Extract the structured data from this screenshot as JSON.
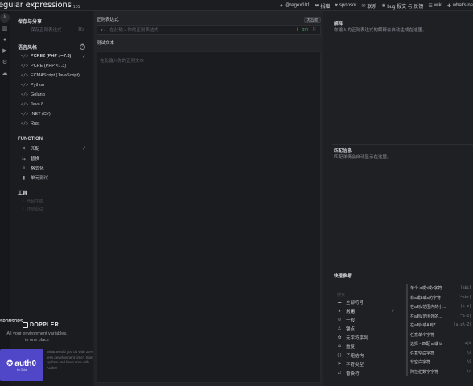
{
  "header": {
    "brand": "egular expressions",
    "version": "101",
    "links": [
      {
        "icon": "twitter-icon",
        "glyph": "✦",
        "label": "@regex101"
      },
      {
        "icon": "donate-icon",
        "glyph": "❤",
        "label": "捐赠"
      },
      {
        "icon": "sponsor-icon",
        "glyph": "♥",
        "label": "sponsor"
      },
      {
        "icon": "mail-icon",
        "glyph": "✉",
        "label": "联系"
      },
      {
        "icon": "bug-icon",
        "glyph": "✱",
        "label": "bug 报交 与 反馈"
      },
      {
        "icon": "wiki-icon",
        "glyph": "☰",
        "label": "wiki"
      },
      {
        "icon": "whats-new-icon",
        "glyph": "✚",
        "label": "what's ne"
      }
    ]
  },
  "sidebar": {
    "save_share_title": "保存与分享",
    "save_share_row": {
      "label": "保存正则表达式",
      "shortcut": "⌘s"
    },
    "flavor_title": "语言风格",
    "flavors": [
      {
        "label": "PCRE2 (PHP >=7.3)",
        "active": true
      },
      {
        "label": "PCRE (PHP <7.3)",
        "active": false
      },
      {
        "label": "ECMAScript (JavaScript)",
        "active": false
      },
      {
        "label": "Python",
        "active": false
      },
      {
        "label": "Golang",
        "active": false
      },
      {
        "label": "Java 8",
        "active": false
      },
      {
        "label": ".NET (C#)",
        "active": false
      },
      {
        "label": "Rust",
        "active": false
      }
    ],
    "function_title": "FUNCTION",
    "functions": [
      {
        "icon": "match-icon",
        "glyph": "⌗",
        "label": "匹配",
        "active": true
      },
      {
        "icon": "substitution-icon",
        "glyph": "⇆",
        "label": "替换",
        "active": false
      },
      {
        "icon": "list-icon",
        "glyph": "≡",
        "label": "格式化",
        "active": false
      },
      {
        "icon": "unit-test-icon",
        "glyph": "▮",
        "label": "单元测试",
        "active": false
      }
    ],
    "tools_title": "工具",
    "tools": [
      "代码生成",
      "正则调试"
    ],
    "sponsors_title": "SPONSORS",
    "doppler_name": "DOPPLER",
    "doppler_tagline": "All your environment variables, in one place",
    "auth0_name": "auth0",
    "auth0_sub": "by Okta",
    "auth0_copy": "What would you do with 25% less development time? Sign up free and have time with Auth0!"
  },
  "editor": {
    "regex_title": "正则表达式",
    "regex_badge": "无匹配",
    "regex_delim_open": "r /",
    "regex_placeholder": "在此输入你的正则表达式",
    "regex_delim_close": "/",
    "regex_flags": "gm",
    "test_title": "测试文本",
    "test_placeholder": "在此输入你的正则文本"
  },
  "right": {
    "explanation_title": "解释",
    "explanation_desc": "你输入的正则表达式的解释会自动生成在这里。",
    "match_title": "匹配信息",
    "match_desc": "匹配详情会自动显示在这里。",
    "quickref_title": "快速参考",
    "quickref_search_placeholder": "搜索",
    "categories": [
      {
        "icon": "all-tokens-icon",
        "glyph": "☁",
        "label": "全部符号",
        "active": false
      },
      {
        "icon": "star-icon",
        "glyph": "★",
        "label": "常用",
        "active": true
      },
      {
        "icon": "general-icon",
        "glyph": "⊙",
        "label": "一般",
        "active": false
      },
      {
        "icon": "anchor-icon",
        "glyph": "⚓",
        "label": "锚点",
        "active": false
      },
      {
        "icon": "meta-icon",
        "glyph": "✿",
        "label": "元字符序列",
        "active": false
      },
      {
        "icon": "quantifier-icon",
        "glyph": "⊕",
        "label": "重复",
        "active": false
      },
      {
        "icon": "group-icon",
        "glyph": "( )",
        "label": "子组结构",
        "active": false
      },
      {
        "icon": "flag-icon",
        "glyph": "⚑",
        "label": "字符类型",
        "active": false
      },
      {
        "icon": "replace-icon",
        "glyph": "⇄",
        "label": "替换符",
        "active": false
      }
    ],
    "items": [
      {
        "label": "单个 a或b或c字符",
        "token": "[abc]"
      },
      {
        "label": "非a或b或c的字符",
        "token": "[^abc]"
      },
      {
        "label": "在a到z范围内的小...",
        "token": "[a-z]"
      },
      {
        "label": "在a到z范围外的...",
        "token": "[^a-z]"
      },
      {
        "label": "在a到z或A到Z...",
        "token": "[a-zA-Z]"
      },
      {
        "label": "任意单个字符",
        "token": "."
      },
      {
        "label": "选择 - 匹配 a 或 b",
        "token": "a|b"
      },
      {
        "label": "任意空白字符",
        "token": "\\s"
      },
      {
        "label": "非空白字符",
        "token": "\\S"
      },
      {
        "label": "阿拉伯数字字符",
        "token": "\\d"
      }
    ]
  }
}
